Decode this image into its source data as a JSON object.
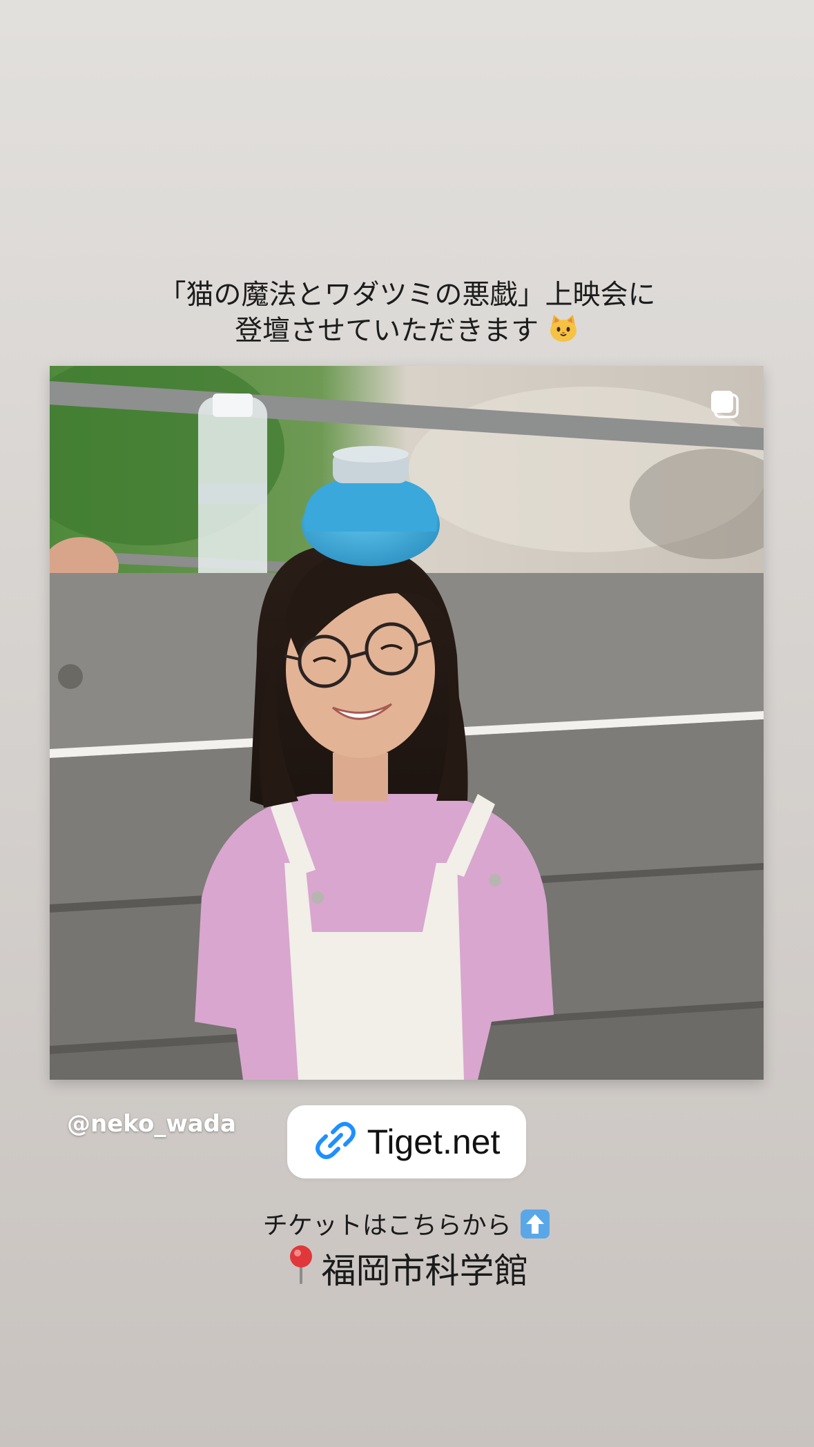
{
  "story": {
    "title_line1": "「猫の魔法とワダツミの悪戯」上映会に",
    "title_line2": "登壇させていただきます",
    "title_emoji": "cat-face-icon",
    "mention": "@neko_wada",
    "link": {
      "icon": "link-icon",
      "label": "Tiget.net",
      "icon_color": "#1e90ff"
    },
    "ticket_text": "チケットはこちらから",
    "ticket_emoji": "up-arrow-icon",
    "venue_emoji": "round-pushpin-icon",
    "venue": "福岡市科学館"
  },
  "photo": {
    "subject": "photo-of-girl-with-ice-pack",
    "multi_image_icon": "multiple-images-icon"
  }
}
